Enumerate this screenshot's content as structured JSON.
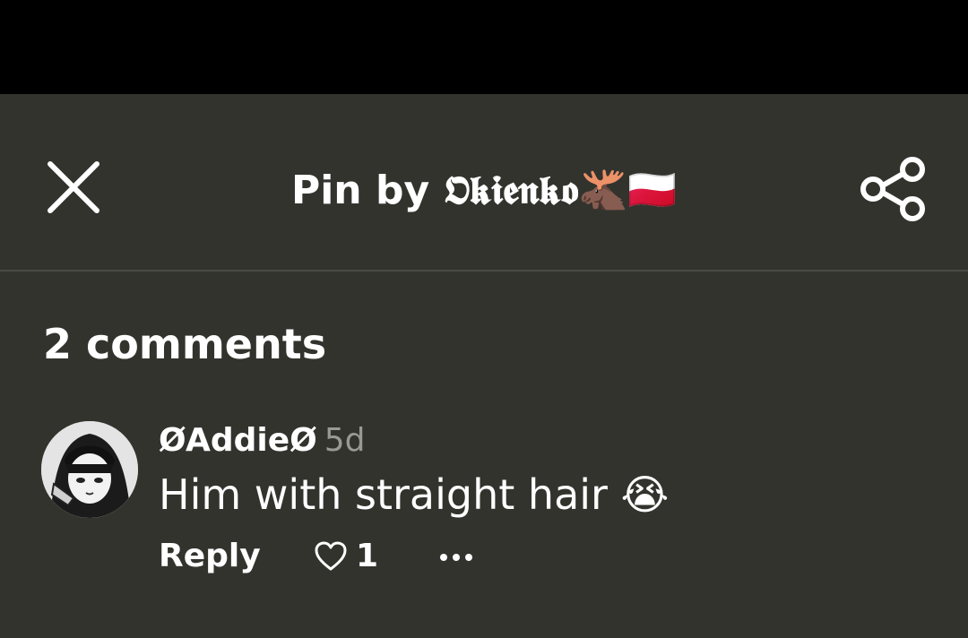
{
  "header": {
    "title": "Pin by 𝕺𝖐𝖎𝖊𝖓𝖐𝖔🫎🇵🇱",
    "close_icon": "close-icon",
    "share_icon": "share-icon"
  },
  "comments": {
    "heading": "2 comments",
    "items": [
      {
        "author": "ØAddieØ",
        "time": "5d",
        "text": "Him with straight hair 😭",
        "reply_label": "Reply",
        "like_count": "1",
        "avatar_icon": "avatar",
        "like_icon": "heart-outline-icon",
        "more_icon": "more-horizontal-icon"
      }
    ]
  },
  "colors": {
    "background": "#33332e",
    "status_bar": "#000000",
    "text": "#ffffff",
    "muted_text": "#9a9a94",
    "divider": "#4a4a45"
  }
}
